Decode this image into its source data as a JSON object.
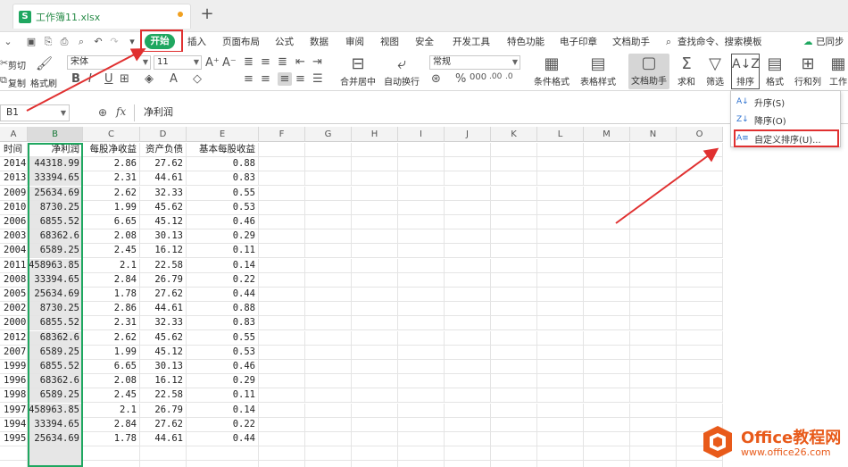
{
  "tabbar": {
    "doc_icon": "S",
    "doc_title": "工作簿11.xlsx",
    "new_tab": "+"
  },
  "menubar": {
    "start": "开始",
    "items": [
      "插入",
      "页面布局",
      "公式",
      "数据",
      "审阅",
      "视图",
      "安全",
      "开发工具",
      "特色功能",
      "电子印章",
      "文档助手"
    ],
    "search": "查找命令、搜索模板",
    "sync": "已同步"
  },
  "ribbon": {
    "cut": "剪切",
    "copy": "复制",
    "format_painter": "格式刷",
    "font_name": "宋体",
    "font_size": "11",
    "merge_center": "合并居中",
    "wrap_text": "自动换行",
    "number_format": "常规",
    "cond_format": "条件格式",
    "table_style": "表格样式",
    "doc_assistant": "文档助手",
    "sum": "求和",
    "filter": "筛选",
    "sort": "排序",
    "format": "格式",
    "rows_cols": "行和列",
    "worksheet": "工作"
  },
  "sort_menu": {
    "ascending": "升序(S)",
    "descending": "降序(O)",
    "custom": "自定义排序(U)..."
  },
  "formulabar": {
    "name_box": "B1",
    "fx": "fx",
    "content": "净利润"
  },
  "grid": {
    "columns": [
      "A",
      "B",
      "C",
      "D",
      "E",
      "F",
      "G",
      "H",
      "I",
      "J",
      "K",
      "L",
      "M",
      "N",
      "O"
    ],
    "headers": [
      "时间",
      "净利润",
      "每股净收益",
      "资产负债",
      "基本每股收益"
    ],
    "rows": [
      [
        "2014",
        "44318.99",
        "2.86",
        "27.62",
        "0.88"
      ],
      [
        "2013",
        "33394.65",
        "2.31",
        "44.61",
        "0.83"
      ],
      [
        "2009",
        "25634.69",
        "2.62",
        "32.33",
        "0.55"
      ],
      [
        "2010",
        "8730.25",
        "1.99",
        "45.62",
        "0.53"
      ],
      [
        "2006",
        "6855.52",
        "6.65",
        "45.12",
        "0.46"
      ],
      [
        "2003",
        "68362.6",
        "2.08",
        "30.13",
        "0.29"
      ],
      [
        "2004",
        "6589.25",
        "2.45",
        "16.12",
        "0.11"
      ],
      [
        "2011",
        "458963.85",
        "2.1",
        "22.58",
        "0.14"
      ],
      [
        "2008",
        "33394.65",
        "2.84",
        "26.79",
        "0.22"
      ],
      [
        "2005",
        "25634.69",
        "1.78",
        "27.62",
        "0.44"
      ],
      [
        "2002",
        "8730.25",
        "2.86",
        "44.61",
        "0.88"
      ],
      [
        "2000",
        "6855.52",
        "2.31",
        "32.33",
        "0.83"
      ],
      [
        "2012",
        "68362.6",
        "2.62",
        "45.62",
        "0.55"
      ],
      [
        "2007",
        "6589.25",
        "1.99",
        "45.12",
        "0.53"
      ],
      [
        "1999",
        "6855.52",
        "6.65",
        "30.13",
        "0.46"
      ],
      [
        "1996",
        "68362.6",
        "2.08",
        "16.12",
        "0.29"
      ],
      [
        "1998",
        "6589.25",
        "2.45",
        "22.58",
        "0.11"
      ],
      [
        "1997",
        "458963.85",
        "2.1",
        "26.79",
        "0.14"
      ],
      [
        "1994",
        "33394.65",
        "2.84",
        "27.62",
        "0.22"
      ],
      [
        "1995",
        "25634.69",
        "1.78",
        "44.61",
        "0.44"
      ]
    ]
  },
  "watermark": {
    "title": "Office教程网",
    "url": "www.office26.com"
  },
  "colors": {
    "accent_green": "#1fa760",
    "highlight_red": "#e03030",
    "watermark_orange": "#e85a1a"
  }
}
